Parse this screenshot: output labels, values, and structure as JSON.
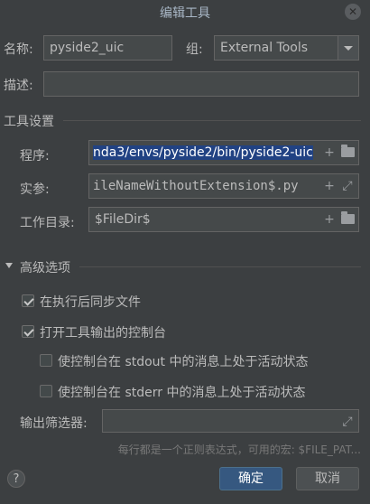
{
  "dialog": {
    "title": "编辑工具",
    "close_label": "✕"
  },
  "top": {
    "name_label": "名称:",
    "name_value": "pyside2_uic",
    "group_label": "组:",
    "group_value": "External Tools",
    "desc_label": "描述:",
    "desc_value": ""
  },
  "tool_settings": {
    "section_title": "工具设置",
    "program_label": "程序:",
    "program_value": "nda3/envs/pyside2/bin/pyside2-uic",
    "args_label": "实参:",
    "args_value": "ileNameWithoutExtension$.py",
    "workdir_label": "工作目录:",
    "workdir_value": "$FileDir$"
  },
  "advanced": {
    "section_title": "高级选项",
    "sync_files": {
      "label": "在执行后同步文件",
      "checked": true
    },
    "open_console": {
      "label": "打开工具输出的控制台",
      "checked": true
    },
    "stdout_active": {
      "label": "使控制台在 stdout 中的消息上处于活动状态",
      "checked": false
    },
    "stderr_active": {
      "label": "使控制台在 stderr 中的消息上处于活动状态",
      "checked": false
    },
    "filter_label": "输出筛选器:",
    "filter_value": "",
    "hint": "每行都是一个正则表达式，可用的宏: $FILE_PAT..."
  },
  "buttons": {
    "help": "?",
    "ok": "确定",
    "cancel": "取消"
  },
  "icons": {
    "add": "+",
    "expand": "⤢"
  }
}
